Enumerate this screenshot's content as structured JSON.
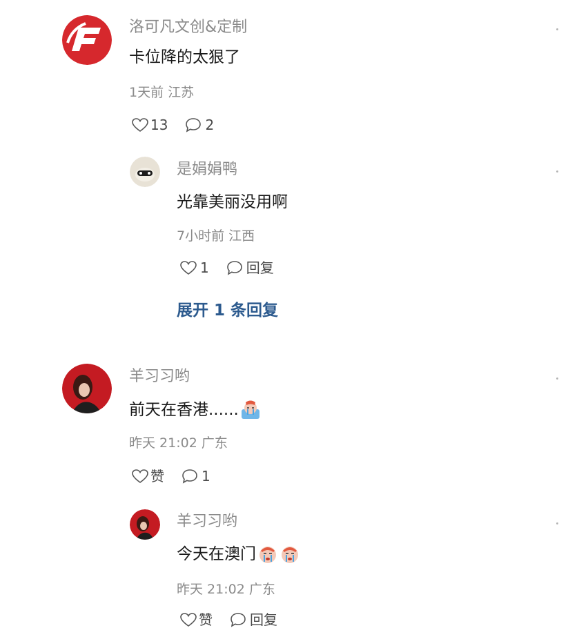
{
  "comments": [
    {
      "name": "洛可凡文创&定制",
      "text": "卡位降的太狠了",
      "meta": "1天前 江苏",
      "likes": "13",
      "replies": "2",
      "avatar_color": "#d6282d",
      "avatar_icon": "brand-f-logo-icon"
    },
    {
      "name": "是娟娟鸭",
      "text": "光靠美丽没用啊",
      "meta": "7小时前 江西",
      "likes": "1",
      "replies": "回复",
      "avatar_color": "#e8e2d6",
      "avatar_icon": "cartoon-avatar-icon"
    },
    {
      "name": "羊习习哟",
      "text": "前天在香港......",
      "meta": "昨天 21:02 广东",
      "likes": "赞",
      "replies": "1",
      "avatar_color": "#c41b22",
      "avatar_icon": "portrait-avatar-icon",
      "emoji": "crying-face-emoji"
    },
    {
      "name": "羊习习哟",
      "text": "今天在澳门",
      "meta": "昨天 21:02 广东",
      "likes": "赞",
      "replies": "回复",
      "avatar_color": "#c41b22",
      "avatar_icon": "portrait-avatar-icon",
      "emoji": "crying-face-emoji"
    }
  ],
  "expand_replies": "展开 1 条回复",
  "colors": {
    "name": "#8a8a8a",
    "text": "#1a1a1a",
    "link": "#2c5a8e"
  }
}
